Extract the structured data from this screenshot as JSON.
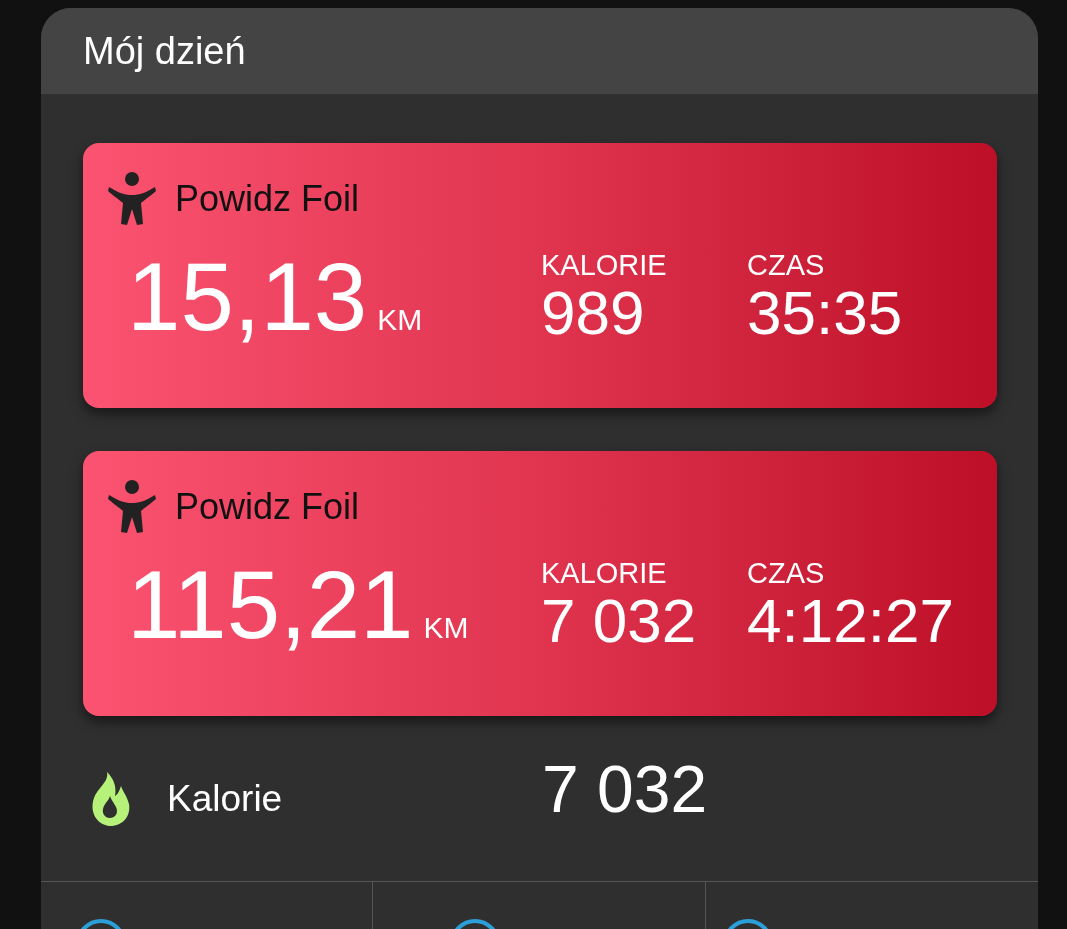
{
  "header": {
    "title": "Mój dzień"
  },
  "activities": [
    {
      "name": "Powidz Foil",
      "distance": "15,13",
      "unit": "KM",
      "stats": [
        {
          "label": "KALORIE",
          "value": "989"
        },
        {
          "label": "CZAS",
          "value": "35:35"
        }
      ]
    },
    {
      "name": "Powidz Foil",
      "distance": "115,21",
      "unit": "KM",
      "stats": [
        {
          "label": "KALORIE",
          "value": "7 032"
        },
        {
          "label": "CZAS",
          "value": "4:12:27"
        }
      ]
    }
  ],
  "summary": {
    "label": "Kalorie",
    "value": "7 032"
  }
}
